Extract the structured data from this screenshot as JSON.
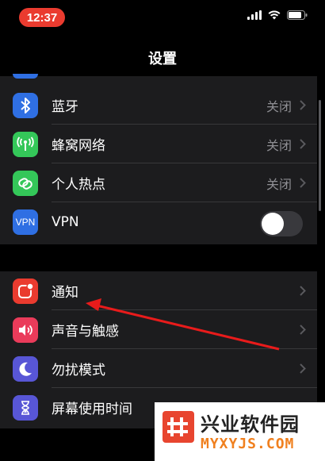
{
  "status_bar": {
    "time": "12:37",
    "icons": [
      "cellular-signal-icon",
      "wifi-icon",
      "battery-icon"
    ]
  },
  "header": {
    "title": "设置"
  },
  "group1": [
    {
      "label": "蓝牙",
      "value": "关闭",
      "icon": "bluetooth-icon",
      "color": "#2f6fe3"
    },
    {
      "label": "蜂窝网络",
      "value": "关闭",
      "icon": "cellular-antenna-icon",
      "color": "#34c759"
    },
    {
      "label": "个人热点",
      "value": "关闭",
      "icon": "hotspot-link-icon",
      "color": "#34c759"
    },
    {
      "label": "VPN",
      "icon_text": "VPN",
      "toggle_on": false,
      "icon": "vpn-icon",
      "color": "#2f6fe3"
    }
  ],
  "group2": [
    {
      "label": "通知",
      "icon": "notification-icon",
      "color": "#ea3b2f"
    },
    {
      "label": "声音与触感",
      "icon": "speaker-icon",
      "color": "#ea3b5a"
    },
    {
      "label": "勿扰模式",
      "icon": "moon-icon",
      "color": "#5856d6"
    },
    {
      "label": "屏幕使用时间",
      "icon": "hourglass-icon",
      "color": "#5856d6"
    }
  ],
  "watermark": {
    "title": "兴业软件园",
    "subtitle": "MYXYJS.COM",
    "accent": "#e8452f"
  },
  "annotation": {
    "arrow_color": "#e81b1b"
  }
}
